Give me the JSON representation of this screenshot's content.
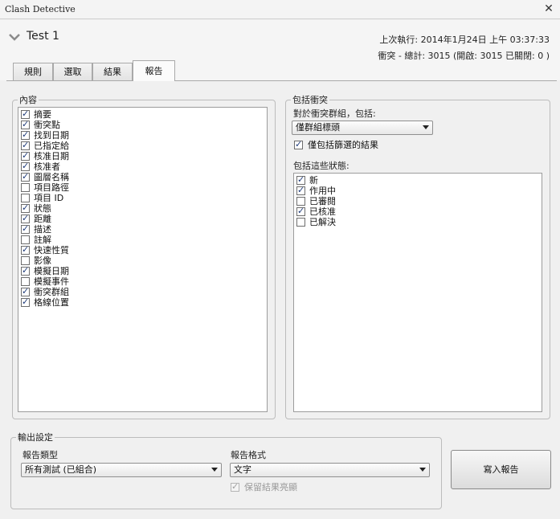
{
  "window": {
    "title": "Clash Detective",
    "close_glyph": "✕"
  },
  "header": {
    "test_name": "Test 1",
    "last_run": "上次執行:  2014年1月24日 上午 03:37:33",
    "clash_summary": "衝突 -  總計: 3015  (開啟:  3015  已關閉:  0 )"
  },
  "tabs": [
    "規則",
    "選取",
    "結果",
    "報告"
  ],
  "active_tab": "報告",
  "contents": {
    "legend": "內容",
    "items": [
      {
        "label": "摘要",
        "checked": true
      },
      {
        "label": "衝突點",
        "checked": true
      },
      {
        "label": "找到日期",
        "checked": true
      },
      {
        "label": "已指定給",
        "checked": true
      },
      {
        "label": "核准日期",
        "checked": true
      },
      {
        "label": "核准者",
        "checked": true
      },
      {
        "label": "圖層名稱",
        "checked": true
      },
      {
        "label": "項目路徑",
        "checked": false
      },
      {
        "label": "項目 ID",
        "checked": false
      },
      {
        "label": "狀態",
        "checked": true
      },
      {
        "label": "距離",
        "checked": true
      },
      {
        "label": "描述",
        "checked": true
      },
      {
        "label": "註解",
        "checked": false
      },
      {
        "label": "快速性質",
        "checked": true
      },
      {
        "label": "影像",
        "checked": false
      },
      {
        "label": "模擬日期",
        "checked": true
      },
      {
        "label": "模擬事件",
        "checked": false
      },
      {
        "label": "衝突群組",
        "checked": true
      },
      {
        "label": "格線位置",
        "checked": true
      }
    ]
  },
  "include_clashes": {
    "legend": "包括衝突",
    "group_label": "對於衝突群組，包括:",
    "group_value": "僅群組標頭",
    "filtered_only_label": "僅包括篩選的結果",
    "filtered_only_checked": true,
    "status_label": "包括這些狀態:",
    "statuses": [
      {
        "label": "新",
        "checked": true
      },
      {
        "label": "作用中",
        "checked": true
      },
      {
        "label": "已審閱",
        "checked": false
      },
      {
        "label": "已核准",
        "checked": true
      },
      {
        "label": "已解決",
        "checked": false
      }
    ]
  },
  "output": {
    "legend": "輸出設定",
    "report_type_label": "報告類型",
    "report_type_value": "所有測試 (已組合)",
    "report_format_label": "報告格式",
    "report_format_value": "文字",
    "keep_highlight_label": "保留結果亮顯",
    "keep_highlight_checked": true,
    "keep_highlight_enabled": false
  },
  "write_report_label": "寫入報告"
}
